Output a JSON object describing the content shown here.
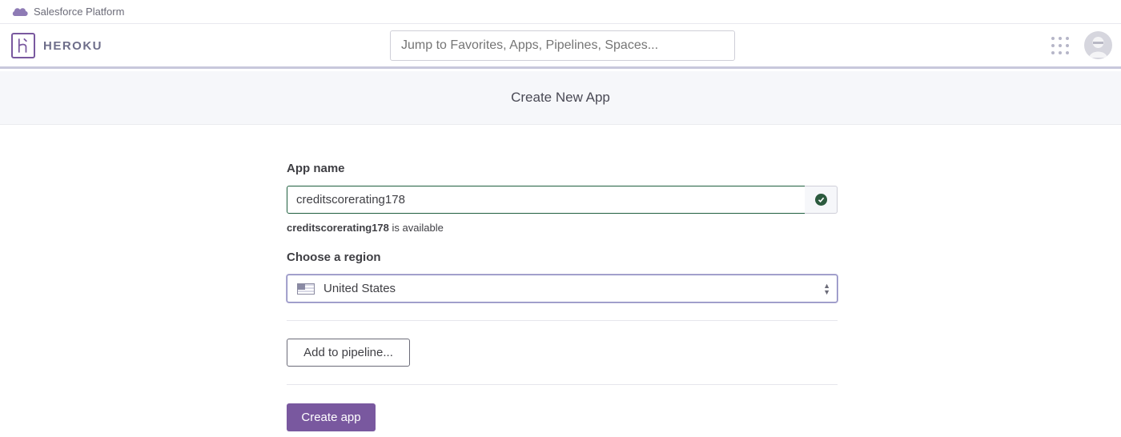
{
  "salesforce_bar": {
    "label": "Salesforce Platform",
    "icon": "salesforce-cloud-icon"
  },
  "header": {
    "logo_icon": "heroku-logo-icon",
    "brand": "HEROKU",
    "search_placeholder": "Jump to Favorites, Apps, Pipelines, Spaces...",
    "apps_icon": "apps-grid-icon",
    "avatar_icon": "user-avatar-icon"
  },
  "page": {
    "title": "Create New App"
  },
  "form": {
    "app_name_label": "App name",
    "app_name_value": "creditscorerating178",
    "availability_name": "creditscorerating178",
    "availability_suffix": " is available",
    "region_label": "Choose a region",
    "region_value": "United States",
    "pipeline_button": "Add to pipeline...",
    "create_button": "Create app"
  },
  "colors": {
    "brand_purple": "#79589f",
    "success_green": "#2c5a3e",
    "title_band_bg": "#f6f7fa"
  }
}
